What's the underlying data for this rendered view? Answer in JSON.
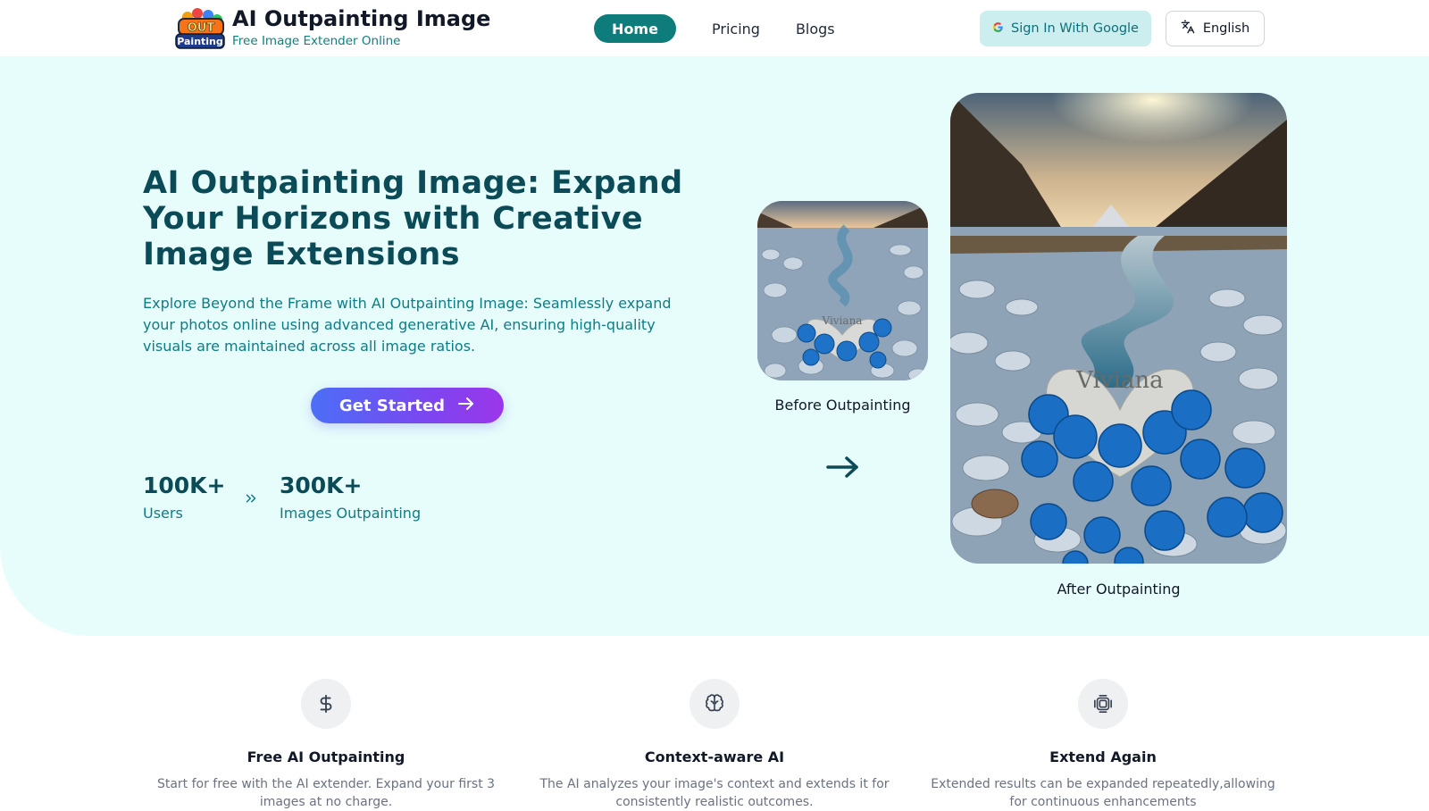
{
  "header": {
    "brand_title": "AI Outpainting Image",
    "brand_subtitle": "Free Image Extender Online",
    "logo_text": "OUT Painting",
    "nav": {
      "home": "Home",
      "pricing": "Pricing",
      "blogs": "Blogs"
    },
    "signin_label": "Sign In With Google",
    "language_label": "English"
  },
  "hero": {
    "title": "AI Outpainting Image: Expand Your Horizons with Creative Image Extensions",
    "description": "Explore Beyond the Frame with AI Outpainting Image: Seamlessly expand your photos online using advanced generative AI, ensuring high-quality visuals are maintained across all image ratios.",
    "cta_label": "Get Started",
    "stats": [
      {
        "value": "100K+",
        "label": "Users"
      },
      {
        "value": "300K+",
        "label": "Images Outpainting"
      }
    ],
    "before_label": "Before Outpainting",
    "after_label": "After Outpainting",
    "stone_text": "Viviana"
  },
  "features": [
    {
      "icon": "dollar-icon",
      "title": "Free AI Outpainting",
      "desc": "Start for free with the AI extender. Expand your first 3 images at no charge."
    },
    {
      "icon": "brain-icon",
      "title": "Context-aware AI",
      "desc": "The AI analyzes your image's context and extends it for consistently realistic outcomes."
    },
    {
      "icon": "layers-icon",
      "title": "Extend Again",
      "desc": "Extended results can be expanded repeatedly,allowing for continuous enhancements"
    }
  ],
  "colors": {
    "brand_teal": "#0e7c7b",
    "hero_bg": "#e7fdfb",
    "heading": "#0b4a57",
    "cta_gradient_start": "#4b6ff7",
    "cta_gradient_end": "#9b36ea"
  }
}
